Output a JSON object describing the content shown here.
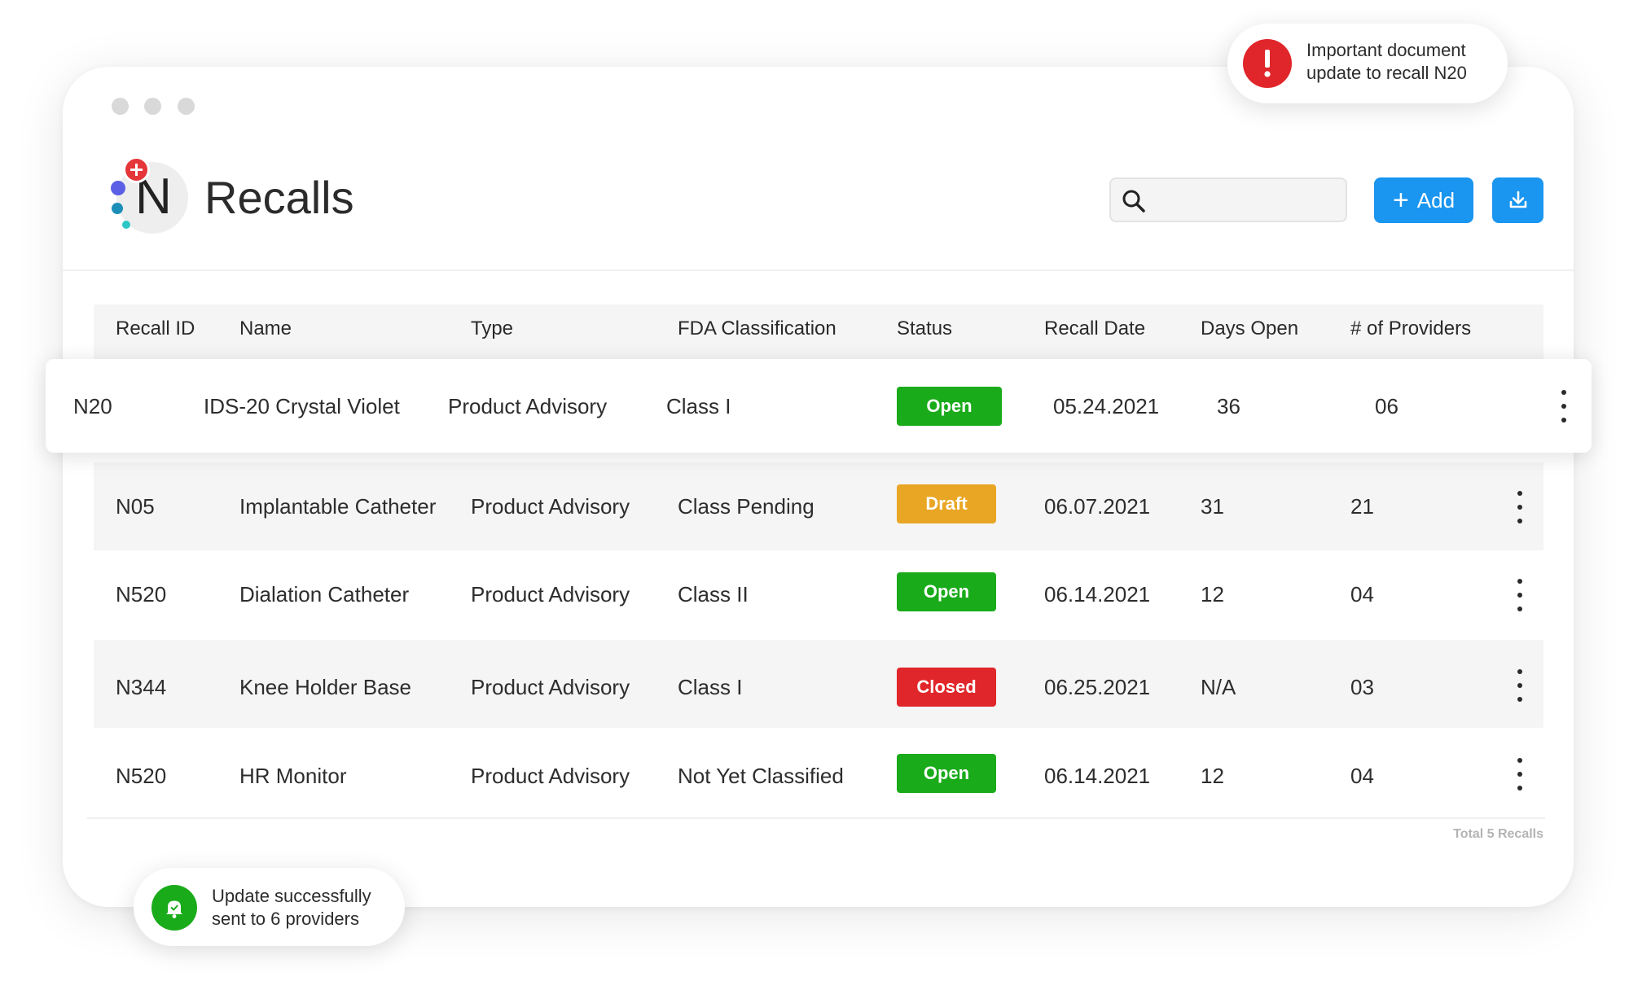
{
  "header": {
    "title": "Recalls",
    "logo_letter": "N",
    "search": {
      "placeholder": ""
    },
    "add_button": {
      "label": "Add",
      "icon": "plus-icon"
    },
    "download_button": {
      "icon": "download-icon"
    }
  },
  "table": {
    "columns": [
      "Recall ID",
      "Name",
      "Type",
      "FDA Classification",
      "Status",
      "Recall Date",
      "Days Open",
      "# of Providers"
    ],
    "highlighted_row": {
      "id": "N20",
      "name": "IDS-20 Crystal Violet",
      "type": "Product Advisory",
      "classification": "Class I",
      "status": "Open",
      "date": "05.24.2021",
      "days_open": "36",
      "providers": "06"
    },
    "rows": [
      {
        "id": "N05",
        "name": "Implantable Catheter",
        "type": "Product Advisory",
        "classification": "Class Pending",
        "status": "Draft",
        "date": "06.07.2021",
        "days_open": "31",
        "providers": "21"
      },
      {
        "id": "N520",
        "name": "Dialation Catheter",
        "type": "Product Advisory",
        "classification": "Class II",
        "status": "Open",
        "date": "06.14.2021",
        "days_open": "12",
        "providers": "04"
      },
      {
        "id": "N344",
        "name": "Knee Holder Base",
        "type": "Product Advisory",
        "classification": "Class I",
        "status": "Closed",
        "date": "06.25.2021",
        "days_open": "N/A",
        "providers": "03"
      },
      {
        "id": "N520",
        "name": "HR Monitor",
        "type": "Product Advisory",
        "classification": "Not Yet Classified",
        "status": "Open",
        "date": "06.14.2021",
        "days_open": "12",
        "providers": "04"
      }
    ],
    "total_label": "Total 5 Recalls"
  },
  "notifications": {
    "alert": {
      "line1": "Important document",
      "line2": "update to recall N20",
      "icon": "alert-icon"
    },
    "success": {
      "line1": "Update successfully",
      "line2": "sent to 6 providers",
      "icon": "bell-icon"
    }
  },
  "colors": {
    "accent": "#1a95f0",
    "status_open": "#1aab1a",
    "status_draft": "#e9a624",
    "status_closed": "#e0262a",
    "alert": "#e0262a",
    "success": "#1aab1a"
  }
}
